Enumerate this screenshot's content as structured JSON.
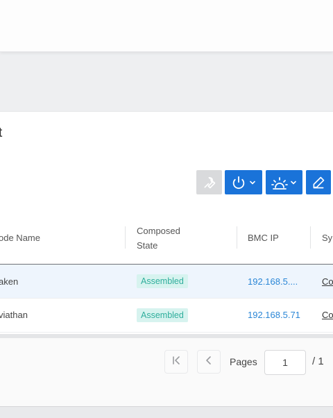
{
  "panel": {
    "title": "t"
  },
  "toolbar": {
    "tools_icon": "wrench-icon",
    "power_icon": "power-icon",
    "light_icon": "indicator-light-icon",
    "edit_icon": "pencil-icon",
    "primary_color": "#1a73d9"
  },
  "table": {
    "headers": {
      "node_name": "ode Name",
      "composed_state": "Composed State",
      "bmc_ip": "BMC IP",
      "system": "Sy"
    },
    "rows": [
      {
        "name": "aken",
        "state": "Assembled",
        "ip": "192.168.5....",
        "system": "Co"
      },
      {
        "name": "viathan",
        "state": "Assembled",
        "ip": "192.168.5.71",
        "system": "Co"
      }
    ]
  },
  "pagination": {
    "label": "Pages",
    "current": "1",
    "total": "/ 1"
  }
}
